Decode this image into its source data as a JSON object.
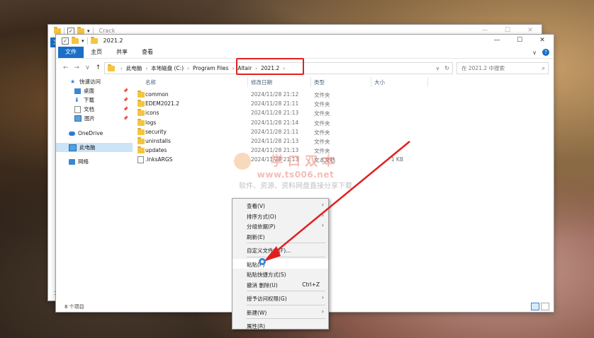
{
  "back_window": {
    "title": "Crack",
    "tab_file": "文",
    "controls": [
      "—",
      "☐",
      "✕"
    ]
  },
  "window": {
    "title": "2021.2",
    "controls": [
      "—",
      "☐",
      "✕"
    ],
    "ribbon_tabs": [
      "文件",
      "主页",
      "共享",
      "查看"
    ],
    "help": "?",
    "ribbon_chevron": "∨"
  },
  "nav": {
    "back": "←",
    "forward": "→",
    "recent": "∨",
    "up": "↑"
  },
  "address": {
    "crumbs": [
      "此电脑",
      "本地磁盘 (C:)",
      "Program Files",
      "Altair",
      "2021.2"
    ],
    "separator": "›",
    "dropdown": "∨",
    "refresh": "↻"
  },
  "search": {
    "placeholder": "在 2021.2 中搜索",
    "icon": "search-icon"
  },
  "sidebar": {
    "items": [
      {
        "label": "快速访问",
        "icon": "star-icon",
        "pinned": false
      },
      {
        "label": "桌面",
        "icon": "desktop-icon",
        "pinned": true
      },
      {
        "label": "下载",
        "icon": "download-icon",
        "pinned": true
      },
      {
        "label": "文档",
        "icon": "document-icon",
        "pinned": true
      },
      {
        "label": "图片",
        "icon": "picture-icon",
        "pinned": true
      },
      {
        "label": "OneDrive",
        "icon": "cloud-icon",
        "pinned": false
      },
      {
        "label": "此电脑",
        "icon": "computer-icon",
        "pinned": false
      },
      {
        "label": "网络",
        "icon": "network-icon",
        "pinned": false
      }
    ],
    "pin": "📌"
  },
  "columns": {
    "name": "名称",
    "date": "修改日期",
    "type": "类型",
    "size": "大小"
  },
  "files": [
    {
      "name": "common",
      "date": "2024/11/28 21:12",
      "type": "文件夹",
      "size": ""
    },
    {
      "name": "EDEM2021.2",
      "date": "2024/11/28 21:11",
      "type": "文件夹",
      "size": ""
    },
    {
      "name": "icons",
      "date": "2024/11/28 21:13",
      "type": "文件夹",
      "size": ""
    },
    {
      "name": "logs",
      "date": "2024/11/28 21:14",
      "type": "文件夹",
      "size": ""
    },
    {
      "name": "security",
      "date": "2024/11/28 21:11",
      "type": "文件夹",
      "size": ""
    },
    {
      "name": "uninstalls",
      "date": "2024/11/28 21:13",
      "type": "文件夹",
      "size": ""
    },
    {
      "name": "updates",
      "date": "2024/11/28 21:13",
      "type": "文件夹",
      "size": ""
    },
    {
      "name": ".lnksARGS",
      "date": "2024/11/28 21:13",
      "type": "文本文档",
      "size": "1 KB"
    }
  ],
  "status": {
    "count": "8 个项目",
    "back_count": "1"
  },
  "watermark": {
    "line1": "学 口 双 本",
    "line2": "www.ts006.net",
    "line3": "软件、资源、资料网盘直接分享下载"
  },
  "context_menu": {
    "items": [
      {
        "label": "查看(V)",
        "shortcut": "",
        "submenu": true
      },
      {
        "label": "排序方式(O)",
        "shortcut": "",
        "submenu": true
      },
      {
        "label": "分组依据(P)",
        "shortcut": "",
        "submenu": true
      },
      {
        "label": "刷新(E)",
        "shortcut": "",
        "submenu": false
      },
      {
        "sep": true
      },
      {
        "label": "自定义文件夹(F)...",
        "shortcut": "",
        "submenu": false
      },
      {
        "sep": true
      },
      {
        "label": "粘贴(P)",
        "shortcut": "",
        "submenu": false,
        "hover": true
      },
      {
        "label": "粘贴快捷方式(S)",
        "shortcut": "",
        "submenu": false
      },
      {
        "label": "撤消 删除(U)",
        "shortcut": "Ctrl+Z",
        "submenu": false
      },
      {
        "sep": true
      },
      {
        "label": "授予访问权限(G)",
        "shortcut": "",
        "submenu": true
      },
      {
        "sep": true
      },
      {
        "label": "新建(W)",
        "shortcut": "",
        "submenu": true
      },
      {
        "sep": true
      },
      {
        "label": "属性(R)",
        "shortcut": "",
        "submenu": false
      }
    ],
    "submenu_arrow": "›"
  },
  "colors": {
    "accent": "#1a6fc6",
    "highlight_box": "#e02020",
    "arrow": "#e02020",
    "selected_sidebar": "#cce4f7"
  }
}
